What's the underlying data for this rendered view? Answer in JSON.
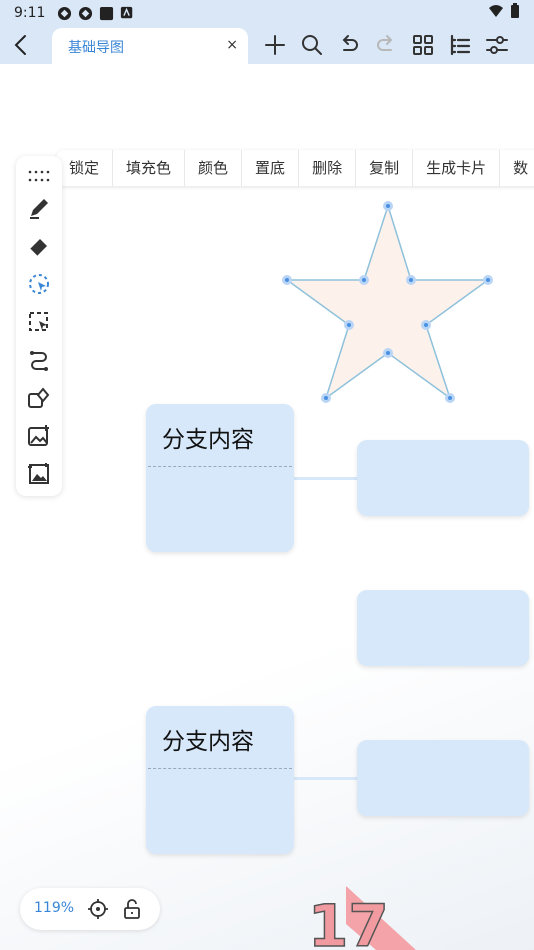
{
  "status_bar": {
    "time": "9:11",
    "icons": [
      "app-icon-1",
      "app-icon-2",
      "app-icon-3",
      "app-icon-4"
    ],
    "right_icons": [
      "wifi-icon",
      "battery-icon"
    ]
  },
  "top_bar": {
    "tab_label": "基础导图",
    "tab_close": "×",
    "actions": [
      "add-icon",
      "search-icon",
      "undo-icon",
      "redo-icon",
      "layout-grid-icon",
      "outline-icon",
      "settings-sliders-icon"
    ]
  },
  "context_menu": {
    "items": [
      "锁定",
      "填充色",
      "颜色",
      "置底",
      "删除",
      "复制",
      "生成卡片",
      "数"
    ]
  },
  "tools": [
    "more-dots-icon",
    "pen-icon",
    "eraser-icon",
    "lasso-select-icon",
    "box-select-icon",
    "connector-icon",
    "shape-icon",
    "add-image-icon",
    "image-frame-icon"
  ],
  "canvas": {
    "nodes": [
      {
        "title": "分支内容"
      },
      {
        "title": "分支内容"
      }
    ],
    "shape": "star",
    "colors": {
      "node_fill": "#d6e8fa",
      "star_fill": "#fdf1ec",
      "star_stroke": "#8ec1db",
      "handle": "#4a90e2",
      "accent": "#3a86d6"
    }
  },
  "zoom": {
    "label": "119%"
  },
  "watermark": {
    "text": "17"
  }
}
